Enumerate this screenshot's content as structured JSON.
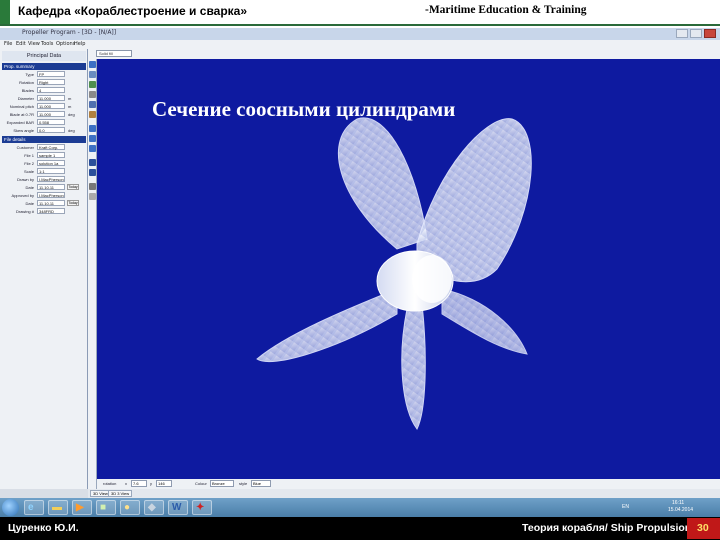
{
  "slide": {
    "header_left": "Кафедра «Кораблестроение и сварка»",
    "header_right": "-Maritime Education & Training",
    "footer_left": "Цуренко Ю.И.",
    "footer_right": "Теория корабля/ Ship Propulsion",
    "page_number": "30"
  },
  "app": {
    "window_title": "Propeller Program - [3D - [N/A]]",
    "menu": [
      "File",
      "Edit",
      "View",
      "Tools",
      "Options",
      "Help"
    ],
    "toolbar_combo": "Solid fill",
    "panel_title": "Principal Data",
    "group_1": "Prop. summary",
    "rows_1": [
      {
        "label": "Type",
        "value": "FP"
      },
      {
        "label": "Rotation",
        "value": "Right"
      },
      {
        "label": "Blades",
        "value": "4"
      },
      {
        "label": "Diameter",
        "value": "11.000",
        "unit": "m"
      },
      {
        "label": "Nominal pitch",
        "value": "11.000",
        "unit": "m"
      },
      {
        "label": "Blade at 0.7R",
        "value": "11.000",
        "unit": "deg"
      },
      {
        "label": "Expanded BAR",
        "value": "0.558"
      },
      {
        "label": "Skew angle",
        "value": "0.0",
        "unit": "deg"
      }
    ],
    "group_2": "File details",
    "rows_2": [
      {
        "label": "Customer",
        "value": "Kraft Corp."
      },
      {
        "label": "File 1",
        "value": "sample 1"
      },
      {
        "label": "File 2",
        "value": "solution 1a"
      },
      {
        "label": "Scale",
        "value": "1:1"
      },
      {
        "label": "Drawn by",
        "value": "I.MacPherson"
      },
      {
        "label": "Date",
        "value": "11.10.11",
        "button": "Today"
      },
      {
        "label": "Approved by",
        "value": "I.MacPherson"
      },
      {
        "label": "Date",
        "value": "11.10.11",
        "button": "Today"
      },
      {
        "label": "Drawing #",
        "value": "348FRD"
      }
    ],
    "viewport_caption": "Сечение соосными цилиндрами",
    "bottom": {
      "rotation_label": "rotation",
      "x_label": "x",
      "x_value": "7.6",
      "y_label": "y",
      "y_value": "146",
      "colour_label": "Colour",
      "colour_value": "Bronze",
      "style_label": "style",
      "style_value": "Blue"
    },
    "view_tabs": [
      "3D View",
      "3D 3 View"
    ]
  },
  "taskbar": {
    "tray_lang": "EN",
    "clock_time": "16:11",
    "clock_date": "15.04.2014"
  },
  "colors": {
    "viewport_bg": "#0e1aa0",
    "header_accent": "#2a7a3a",
    "page_badge": "#c01818"
  }
}
